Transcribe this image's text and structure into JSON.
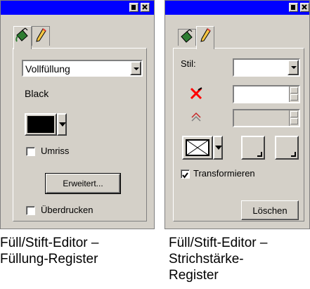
{
  "panel_fill": {
    "title_buttons": [
      "minimize",
      "close"
    ],
    "tabs": [
      {
        "icon": "paint-bucket-icon",
        "active": true
      },
      {
        "icon": "pen-icon",
        "active": false
      }
    ],
    "fill_type": "Vollfüllung",
    "color_name": "Black",
    "color_swatch": "#000000",
    "outline_label": "Umriss",
    "outline_checked": false,
    "advanced_button": "Erweitert...",
    "overprint_label": "Überdrucken",
    "overprint_checked": false
  },
  "panel_stroke": {
    "title_buttons": [
      "minimize",
      "close"
    ],
    "tabs": [
      {
        "icon": "paint-bucket-icon",
        "active": false
      },
      {
        "icon": "pen-icon",
        "active": true
      }
    ],
    "style_label": "Stil:",
    "style_value": "",
    "width_icon": "no-stroke-icon",
    "width_value": "",
    "miter_icon": "miter-icon",
    "miter_value": "",
    "line_end_icon": "crossed-box-icon",
    "transform_label": "Transformieren",
    "transform_checked": true,
    "delete_button": "Löschen"
  },
  "captions": {
    "fill": "Füll/Stift-Editor –\nFüllung-Register",
    "stroke": "Füll/Stift-Editor –\nStrichstärke-\nRegister"
  },
  "colors": {
    "titlebar": "#0000ff",
    "panel": "#d4d0c8",
    "swatch": "#000000",
    "no_stroke_icon": "#ff0000"
  }
}
